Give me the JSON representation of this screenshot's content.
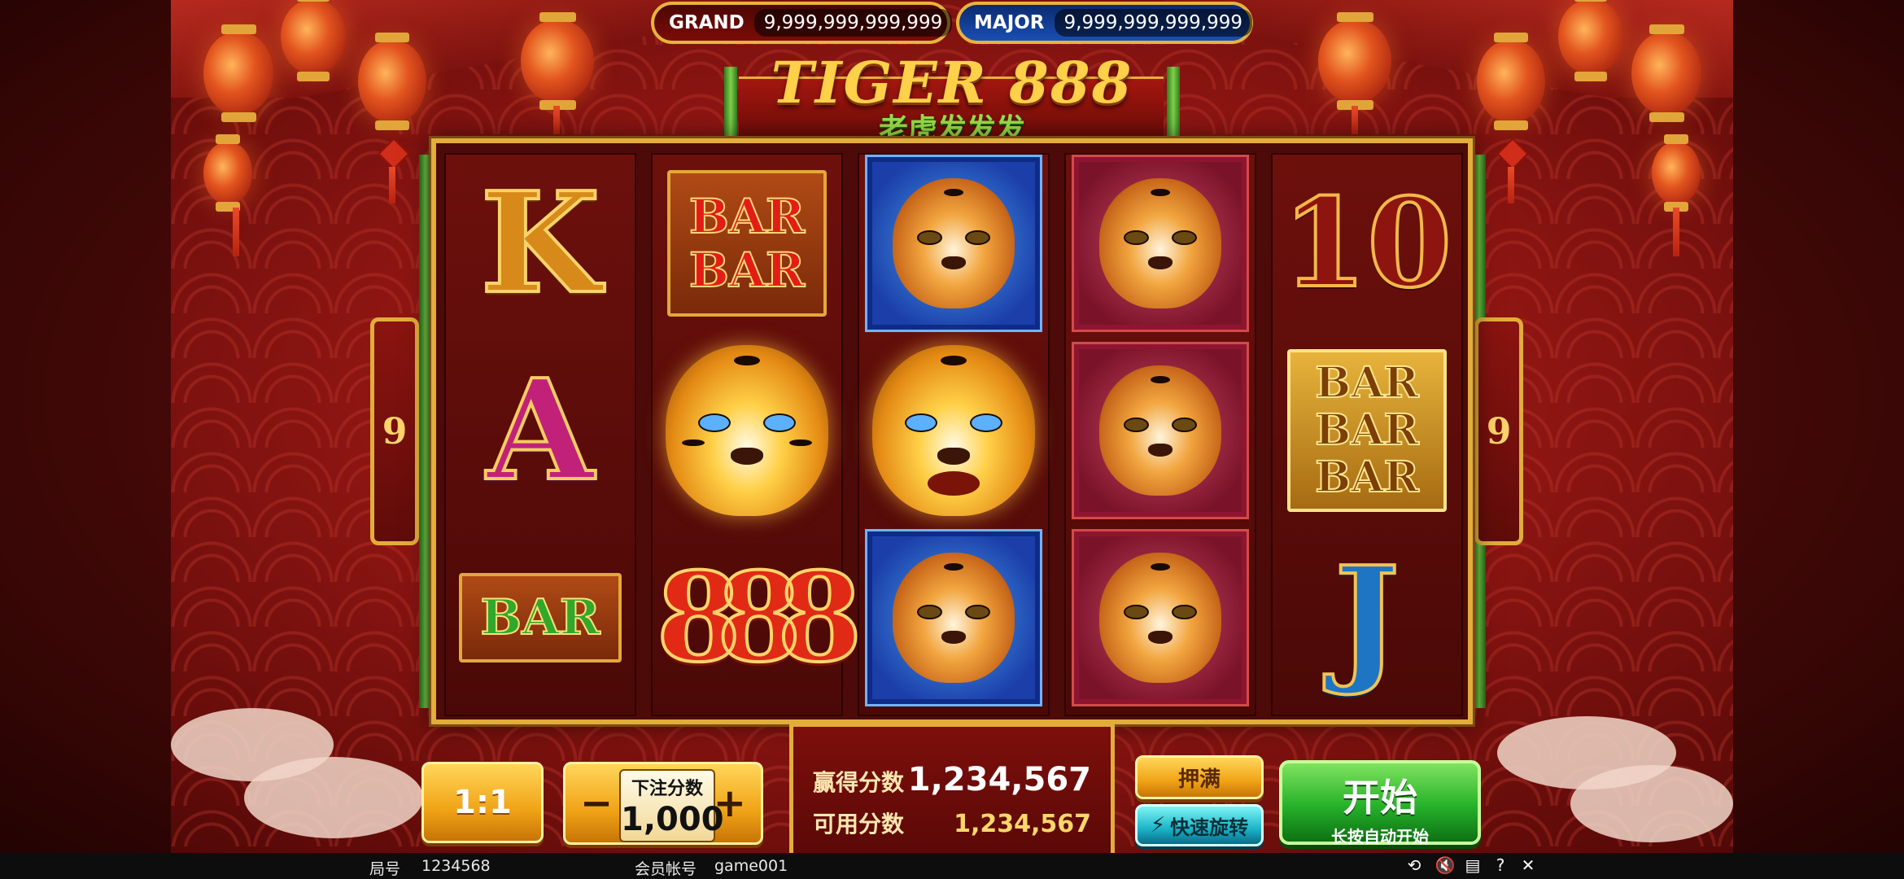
{
  "jackpots": {
    "grand": {
      "label": "GRAND",
      "value": "9,999,999,999,999"
    },
    "major": {
      "label": "MAJOR",
      "value": "9,999,999,999,999"
    }
  },
  "logo": {
    "title": "TIGER 888",
    "subtitle": "老虎发发发"
  },
  "paylines": {
    "left": "9",
    "right": "9"
  },
  "reels": [
    [
      "K",
      "A",
      "BAR"
    ],
    [
      "BAR BAR",
      "gold-tiger",
      "8-8-8"
    ],
    [
      "blue-tiger",
      "gold-tiger-roaring",
      "blue-tiger"
    ],
    [
      "red-tiger",
      "red-tiger",
      "red-tiger"
    ],
    [
      "10",
      "BAR BAR BAR",
      "J"
    ]
  ],
  "symbol_text": {
    "K": "K",
    "A": "A",
    "ten": "10",
    "J": "J",
    "bar": "BAR",
    "eights": "888"
  },
  "controls": {
    "ratio": "1:1",
    "bet_label": "下注分数",
    "bet_value": "1,000",
    "bet_minus": "−",
    "bet_plus": "+",
    "win_label": "赢得分数",
    "win_value": "1,234,567",
    "avail_label": "可用分数",
    "avail_value": "1,234,567",
    "max_bet": "押满",
    "quick_spin": "快速旋转",
    "start": "开始",
    "start_sub": "长按自动开始"
  },
  "status_bar": {
    "round_label": "局号",
    "round_value": "1234568",
    "account_label": "会员帐号",
    "account_value": "game001"
  },
  "colors": {
    "gold_border": "#e2ad3b",
    "background_red": "#8c1512",
    "start_green": "#26b12a",
    "quick_cyan": "#1bb3c8"
  }
}
